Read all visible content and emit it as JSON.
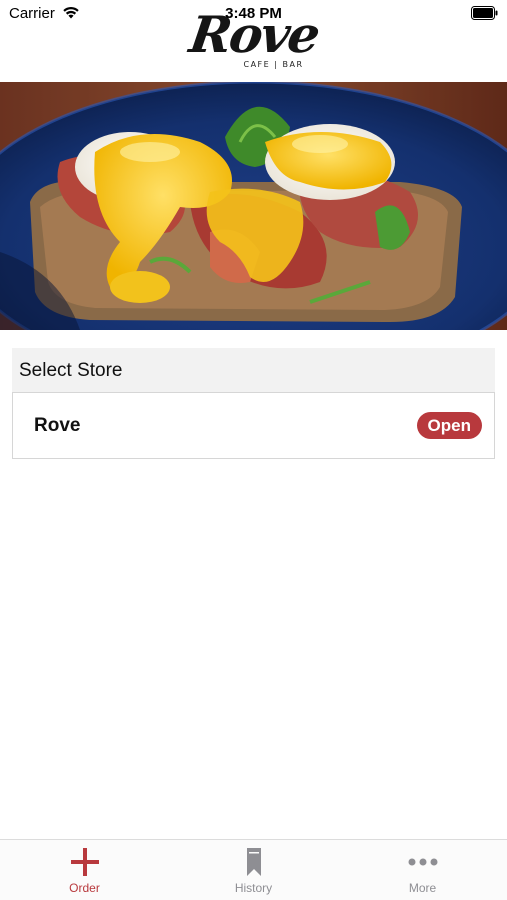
{
  "status_bar": {
    "carrier": "Carrier",
    "time": "3:48 PM"
  },
  "header": {
    "logo_text": "Rove",
    "logo_subtext": "CAFE | BAR"
  },
  "store_list": {
    "section_title": "Select Store",
    "stores": [
      {
        "name": "Rove",
        "status": "Open"
      }
    ]
  },
  "tab_bar": {
    "tabs": [
      {
        "label": "Order",
        "icon": "plus-icon",
        "active": true
      },
      {
        "label": "History",
        "icon": "bookmark-icon",
        "active": false
      },
      {
        "label": "More",
        "icon": "more-dots-icon",
        "active": false
      }
    ]
  },
  "colors": {
    "accent": "#b8393d",
    "tab_inactive": "#8e8e93",
    "section_header_bg": "#f2f2f2"
  }
}
